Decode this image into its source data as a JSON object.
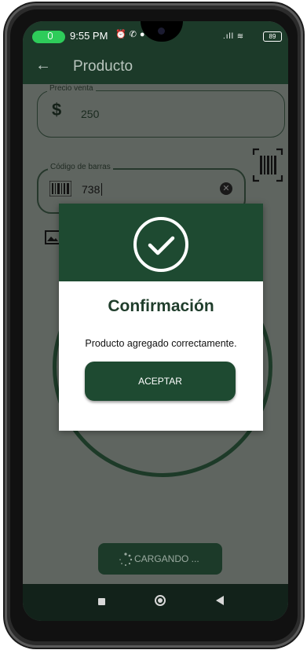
{
  "status_bar": {
    "time": "9:55 PM",
    "icons": [
      "mic-icon",
      "alarm-icon",
      "phone-icon",
      "location-icon"
    ],
    "indicators": [
      "signal-icon",
      "wifi-icon"
    ],
    "battery": "89"
  },
  "app_bar": {
    "back_icon": "arrow-left-icon",
    "title": "Producto"
  },
  "form": {
    "price_label": "Precio venta",
    "price_symbol": "$",
    "price_value": "250",
    "barcode_label": "Código de barras",
    "barcode_value": "738"
  },
  "loading_button": {
    "label": "CARGANDO ..."
  },
  "dialog": {
    "title": "Confirmación",
    "message": "Producto agregado correctamente.",
    "accept_label": "ACEPTAR"
  },
  "colors": {
    "primary": "#1e4a31",
    "status_bar": "#1c3a29",
    "overlay": "#5f6560",
    "pill": "#2ecc5a"
  },
  "navigation": {
    "icons": [
      "recents-icon",
      "home-icon",
      "back-icon"
    ]
  }
}
